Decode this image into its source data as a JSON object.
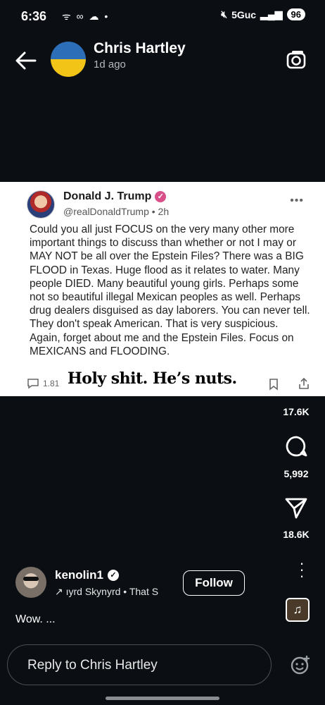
{
  "status_bar": {
    "time": "6:36",
    "left_icons": "ᯤ ∞ ☁ •",
    "network": "5Guc",
    "signal": "▂▄▆",
    "battery": "96"
  },
  "header": {
    "author": "Chris Hartley",
    "time_ago": "1d ago",
    "back_icon": "arrow-left-icon",
    "camera_icon": "camera-icon"
  },
  "tweet": {
    "name": "Donald J. Trump",
    "handle": "@realDonaldTrump • 2h",
    "body": "Could you all just FOCUS on the very many other more important things to discuss than whether or not I may or MAY NOT be all over the Epstein Files? There was a BIG FLOOD in Texas. Huge flood as it relates to water. Many people DIED. Many beautiful young girls. Perhaps some not so beautiful illegal Mexican peoples as well. Perhaps drug dealers disguised as day laborers. You can never tell. They don't speak American. That is very suspicious. Again, forget about me and the Epstein Files. Focus on MEXICANS and FLOODING.",
    "reply_count": "1.81",
    "more": "•••"
  },
  "overlay_text": "Holy shit. He’s nuts.",
  "actions": {
    "likes": "17.6K",
    "comments": "5,992",
    "shares": "18.6K"
  },
  "commenter": {
    "name": "kenolin1",
    "music": "↗ ıyrd Skynyrd • That S",
    "follow_label": "Follow"
  },
  "caption": "Wow. ...",
  "reply": {
    "placeholder": "Reply to Chris Hartley"
  },
  "colors": {
    "background": "#0b0f14",
    "verified_pink": "#d94f8a"
  }
}
